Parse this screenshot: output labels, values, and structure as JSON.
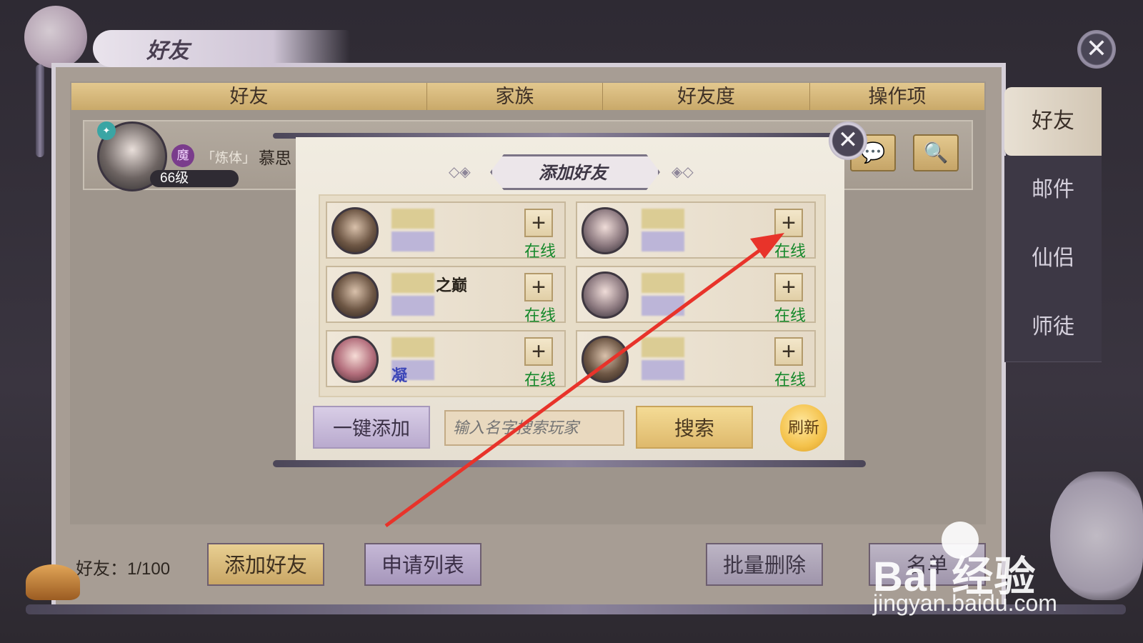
{
  "window": {
    "title": "好友",
    "close_glyph": "✕"
  },
  "table_header": {
    "friend": "好友",
    "clan": "家族",
    "affinity": "好友度",
    "actions": "操作项"
  },
  "friend_row": {
    "badge": "✦",
    "clan_badge": "魔",
    "realm": "「炼体」",
    "name": "慕思",
    "level": "66级",
    "chat_glyph": "💬",
    "search_glyph": "🔍"
  },
  "side_tabs": [
    "好友",
    "邮件",
    "仙侣",
    "师徒"
  ],
  "bottom": {
    "count": "好友：1/100",
    "add_friend": "添加好友",
    "apply_list": "申请列表",
    "batch_delete": "批量删除",
    "partial": "名单"
  },
  "dialog": {
    "title": "添加好友",
    "ornament_left": "◇◈",
    "ornament_right": "◈◇",
    "close_glyph": "✕",
    "cards": [
      {
        "tail": "",
        "tail2": "",
        "status": "在线",
        "plus": "+"
      },
      {
        "tail": "",
        "tail2": "",
        "status": "在线",
        "plus": "+"
      },
      {
        "tail": "之巅",
        "tail2": "",
        "status": "在线",
        "plus": "+"
      },
      {
        "tail": "",
        "tail2": "",
        "status": "在线",
        "plus": "+"
      },
      {
        "tail": "",
        "tail2": "凝",
        "status": "在线",
        "plus": "+"
      },
      {
        "tail": "",
        "tail2": "",
        "status": "在线",
        "plus": "+"
      }
    ],
    "one_key_add": "一键添加",
    "search_placeholder": "输入名字搜索玩家",
    "search_button": "搜索",
    "refresh_button": "刷新"
  },
  "watermark": {
    "logo": "Bai  经验",
    "url": "jingyan.baidu.com"
  },
  "colors": {
    "arrow": "#e8332a",
    "online": "#14882a",
    "gold": "#e3c88e"
  }
}
